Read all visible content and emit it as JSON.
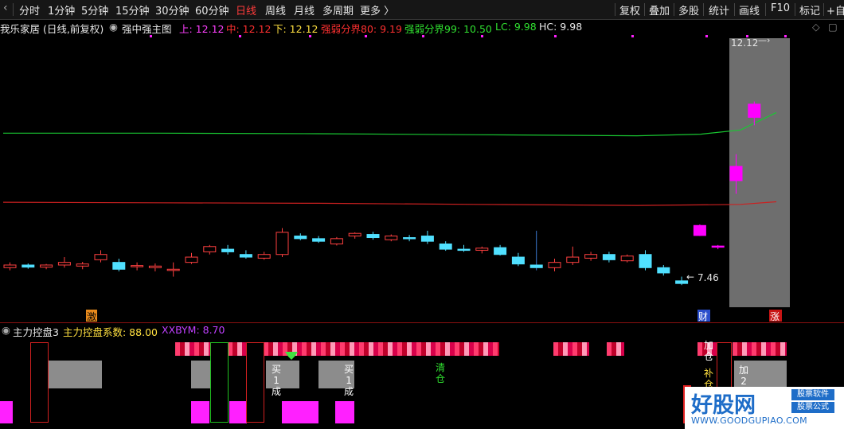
{
  "toolbar": {
    "items": [
      "分时",
      "1分钟",
      "5分钟",
      "15分钟",
      "30分钟",
      "60分钟",
      "日线",
      "周线",
      "月线",
      "多周期",
      "更多 〉"
    ],
    "active_index": 6,
    "right_items": [
      "复权",
      "叠加",
      "多股",
      "统计",
      "画线",
      "F10",
      "标记",
      "+自"
    ]
  },
  "info": {
    "stock": "我乐家居 (日线,前复权)",
    "indicator": "强中强主图",
    "up": "上: 12.12",
    "mid": "中: 12.12",
    "down": "下: 12.12",
    "q80": "强弱分界80: 9.19",
    "q99": "强弱分界99: 10.50",
    "lc": "LC: 9.98",
    "hc": "HC: 9.98"
  },
  "price_panel": {
    "high_label": "12.12",
    "low_label": "7.46",
    "markers": [
      "激",
      "财",
      "涨"
    ]
  },
  "indicator_panel": {
    "name": "主力控盘3",
    "coef": "主力控盘系数: 88.00",
    "xxbym": "XXBYM: 8.70",
    "signals": [
      "买\n1\n成",
      "买\n1\n成",
      "清\n仓",
      "加\n仓",
      "补\n仓",
      "加\n2"
    ]
  },
  "watermark": {
    "name": "好股网",
    "tag1": "股票软件",
    "tag2": "股票公式",
    "url": "WWW.GOODGUPIAO.COM"
  },
  "chart_data": {
    "type": "candlestick",
    "ohlc": [
      [
        7.95,
        8.05,
        7.9,
        8.0
      ],
      [
        8.0,
        8.03,
        7.93,
        7.96
      ],
      [
        7.96,
        8.02,
        7.92,
        8.0
      ],
      [
        8.0,
        8.15,
        7.95,
        8.05
      ],
      [
        7.98,
        8.06,
        7.92,
        8.02
      ],
      [
        8.1,
        8.28,
        8.05,
        8.2
      ],
      [
        8.05,
        8.12,
        7.88,
        7.92
      ],
      [
        7.98,
        8.05,
        7.9,
        7.99
      ],
      [
        7.95,
        8.03,
        7.88,
        7.98
      ],
      [
        7.9,
        8.05,
        7.78,
        7.92
      ],
      [
        8.05,
        8.23,
        8.02,
        8.15
      ],
      [
        8.25,
        8.38,
        8.2,
        8.35
      ],
      [
        8.3,
        8.38,
        8.2,
        8.25
      ],
      [
        8.2,
        8.28,
        8.12,
        8.15
      ],
      [
        8.13,
        8.25,
        8.1,
        8.2
      ],
      [
        8.2,
        8.7,
        8.15,
        8.62
      ],
      [
        8.55,
        8.6,
        8.47,
        8.5
      ],
      [
        8.5,
        8.55,
        8.42,
        8.45
      ],
      [
        8.4,
        8.53,
        8.37,
        8.5
      ],
      [
        8.55,
        8.62,
        8.5,
        8.6
      ],
      [
        8.58,
        8.63,
        8.48,
        8.52
      ],
      [
        8.48,
        8.58,
        8.45,
        8.55
      ],
      [
        8.52,
        8.57,
        8.45,
        8.5
      ],
      [
        8.55,
        8.65,
        8.4,
        8.45
      ],
      [
        8.4,
        8.45,
        8.27,
        8.3
      ],
      [
        8.3,
        8.38,
        8.25,
        8.28
      ],
      [
        8.28,
        8.35,
        8.22,
        8.32
      ],
      [
        8.33,
        8.38,
        8.18,
        8.2
      ],
      [
        8.15,
        8.23,
        7.98,
        8.02
      ],
      [
        8.0,
        8.65,
        7.9,
        7.95
      ],
      [
        7.95,
        8.12,
        7.88,
        8.05
      ],
      [
        8.05,
        8.35,
        8.0,
        8.15
      ],
      [
        8.13,
        8.25,
        8.08,
        8.2
      ],
      [
        8.2,
        8.25,
        8.05,
        8.1
      ],
      [
        8.08,
        8.2,
        8.05,
        8.17
      ],
      [
        8.2,
        8.28,
        7.9,
        7.95
      ],
      [
        7.95,
        8.0,
        7.8,
        7.85
      ],
      [
        7.7,
        7.78,
        7.62,
        7.65
      ],
      [
        8.56,
        8.77,
        8.55,
        8.75
      ],
      [
        8.35,
        8.38,
        8.3,
        8.36
      ],
      [
        9.6,
        10.1,
        9.35,
        9.87
      ],
      [
        10.8,
        11.1,
        10.65,
        11.05
      ]
    ],
    "up_color": "#ff4040",
    "down_color": "#50e0ff",
    "limit_up_color": "#ff00ff",
    "lines": [
      {
        "name": "强弱分界99",
        "color": "#19c832",
        "values": [
          10.5,
          10.5,
          10.49,
          10.47,
          10.45,
          10.48,
          10.56,
          10.89
        ]
      },
      {
        "name": "强弱分界80",
        "color": "#cc2020",
        "values": [
          9.19,
          9.18,
          9.17,
          9.15,
          9.13,
          9.14,
          9.15,
          9.2
        ]
      }
    ],
    "ylim": [
      7.2,
      12.3
    ]
  }
}
